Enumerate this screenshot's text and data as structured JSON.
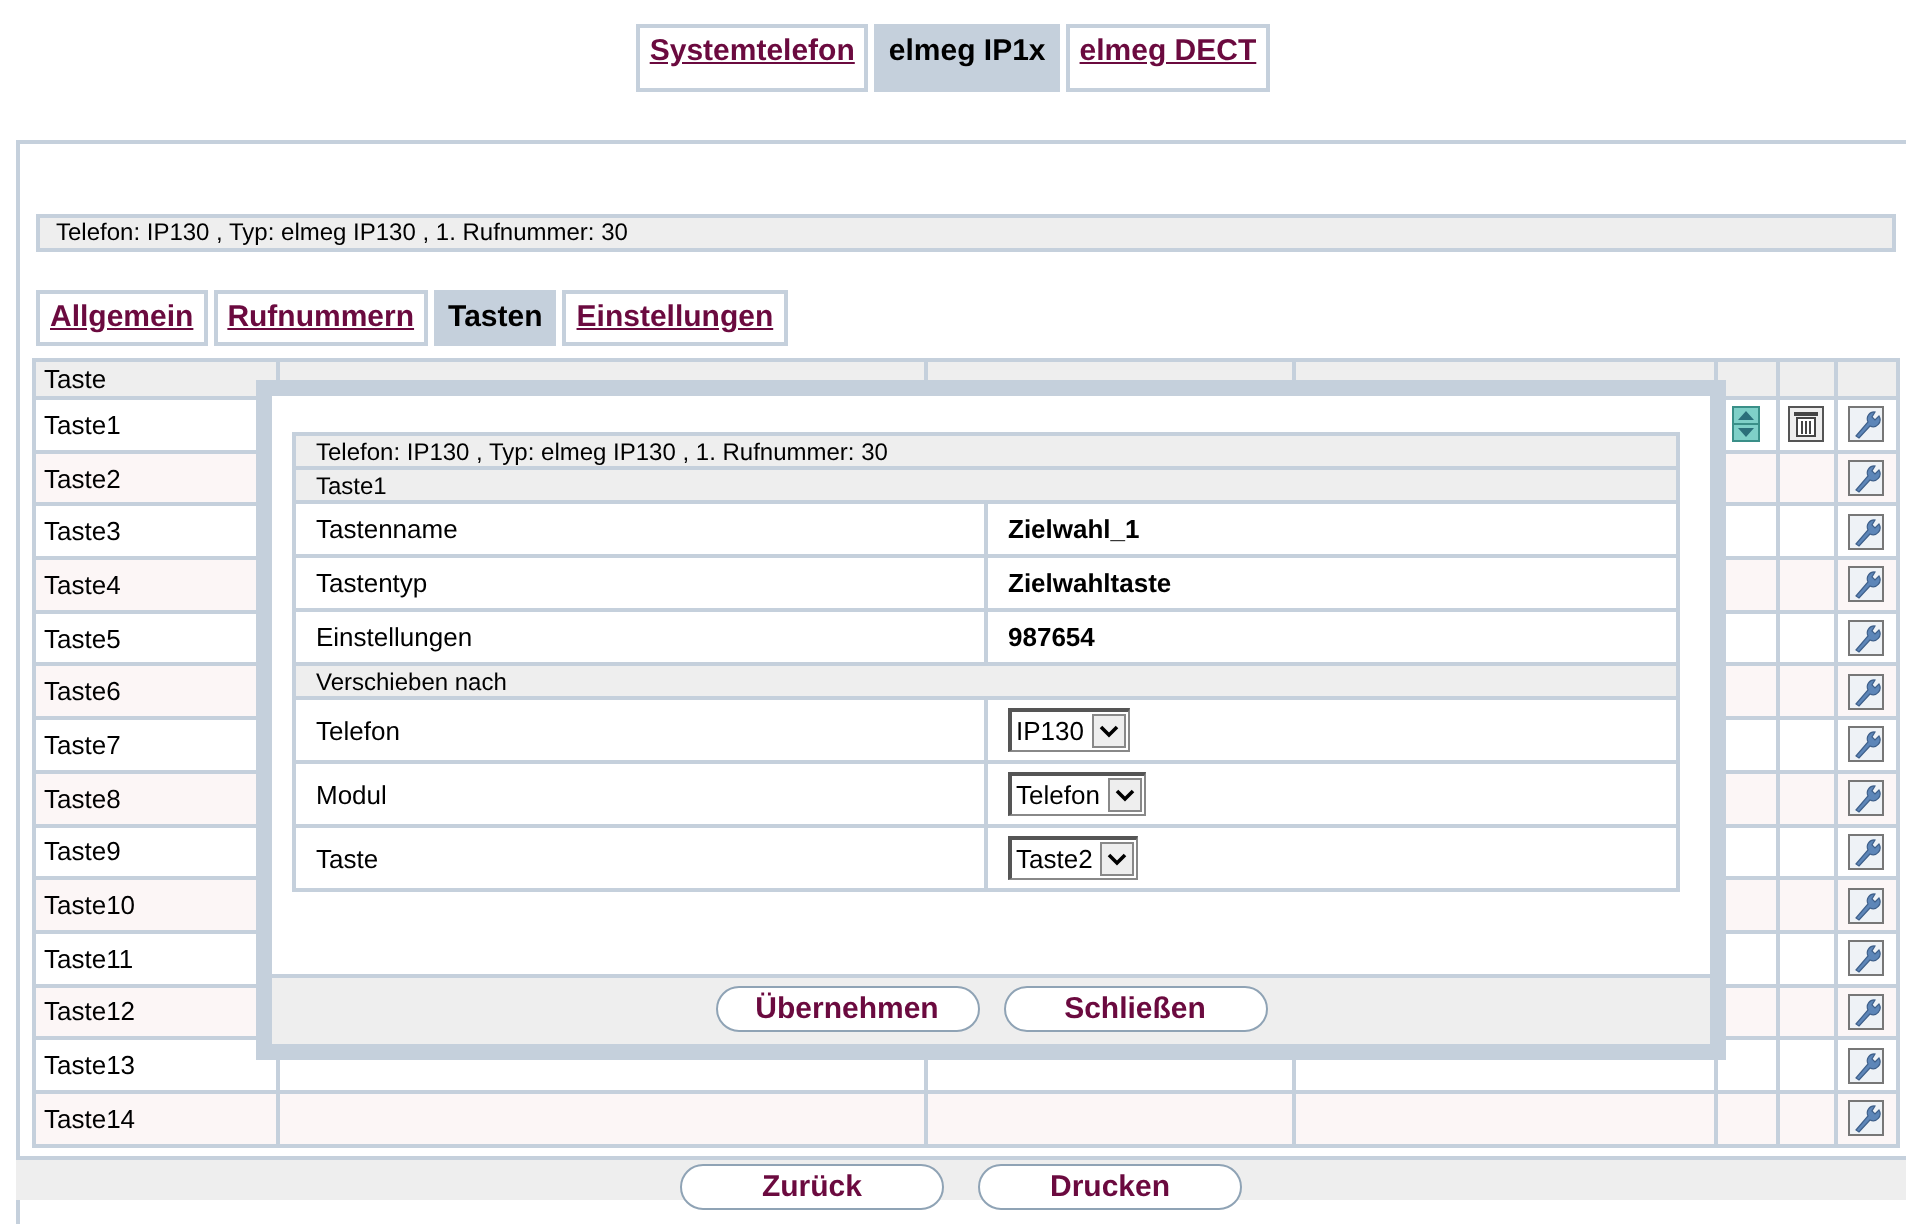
{
  "top_tabs": [
    {
      "label": "Systemtelefon",
      "selected": false
    },
    {
      "label": "elmeg IP1x",
      "selected": true
    },
    {
      "label": "elmeg DECT",
      "selected": false
    }
  ],
  "info_bar": "Telefon: IP130 , Typ: elmeg IP130 , 1. Rufnummer: 30",
  "sub_tabs": [
    {
      "label": "Allgemein",
      "selected": false
    },
    {
      "label": "Rufnummern",
      "selected": false
    },
    {
      "label": "Tasten",
      "selected": true
    },
    {
      "label": "Einstellungen",
      "selected": false
    }
  ],
  "table": {
    "columns": [
      "Taste"
    ],
    "rows": [
      {
        "taste": "Taste1",
        "movable": true,
        "deletable": true
      },
      {
        "taste": "Taste2",
        "movable": false,
        "deletable": false
      },
      {
        "taste": "Taste3",
        "movable": false,
        "deletable": false
      },
      {
        "taste": "Taste4",
        "movable": false,
        "deletable": false
      },
      {
        "taste": "Taste5",
        "movable": false,
        "deletable": false
      },
      {
        "taste": "Taste6",
        "movable": false,
        "deletable": false
      },
      {
        "taste": "Taste7",
        "movable": false,
        "deletable": false
      },
      {
        "taste": "Taste8",
        "movable": false,
        "deletable": false
      },
      {
        "taste": "Taste9",
        "movable": false,
        "deletable": false
      },
      {
        "taste": "Taste10",
        "movable": false,
        "deletable": false
      },
      {
        "taste": "Taste11",
        "movable": false,
        "deletable": false
      },
      {
        "taste": "Taste12",
        "movable": false,
        "deletable": false
      },
      {
        "taste": "Taste13",
        "movable": false,
        "deletable": false
      },
      {
        "taste": "Taste14",
        "movable": false,
        "deletable": false
      }
    ]
  },
  "dialog": {
    "rows": [
      {
        "kind": "header",
        "label": "Telefon: IP130 , Typ: elmeg IP130 , 1. Rufnummer: 30"
      },
      {
        "kind": "header",
        "label": "Taste1"
      },
      {
        "kind": "text",
        "label": "Tastenname",
        "value": "Zielwahl_1"
      },
      {
        "kind": "text",
        "label": "Tastentyp",
        "value": "Zielwahltaste"
      },
      {
        "kind": "text",
        "label": "Einstellungen",
        "value": "987654"
      },
      {
        "kind": "header",
        "label": "Verschieben nach"
      },
      {
        "kind": "select",
        "label": "Telefon",
        "value": "IP130"
      },
      {
        "kind": "select",
        "label": "Modul",
        "value": "Telefon"
      },
      {
        "kind": "select",
        "label": "Taste",
        "value": "Taste2"
      }
    ],
    "buttons": [
      "Übernehmen",
      "Schließen"
    ]
  },
  "footer_buttons": [
    "Zurück",
    "Drucken"
  ]
}
